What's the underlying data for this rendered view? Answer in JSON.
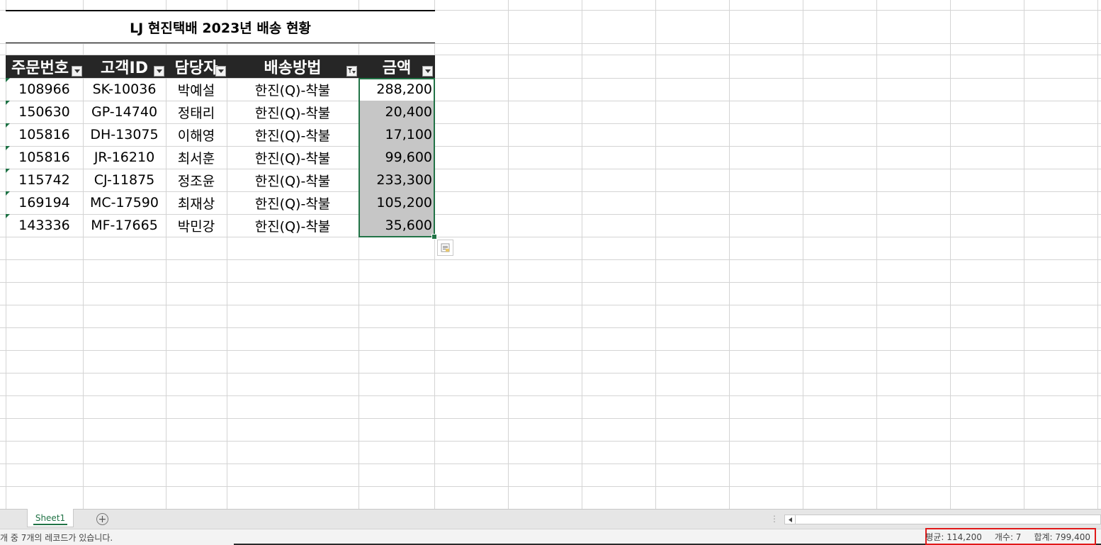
{
  "title": "LJ 현진택배 2023년 배송 현황",
  "table": {
    "headers": [
      "주문번호",
      "고객ID",
      "담당자",
      "배송방법",
      "금액"
    ],
    "rows": [
      [
        "108966",
        "SK-10036",
        "박예설",
        "한진(Q)-착불",
        "288,200"
      ],
      [
        "150630",
        "GP-14740",
        "정태리",
        "한진(Q)-착불",
        "20,400"
      ],
      [
        "105816",
        "DH-13075",
        "이해영",
        "한진(Q)-착불",
        "17,100"
      ],
      [
        "105816",
        "JR-16210",
        "최서훈",
        "한진(Q)-착불",
        "99,600"
      ],
      [
        "115742",
        "CJ-11875",
        "정조윤",
        "한진(Q)-착불",
        "233,300"
      ],
      [
        "169194",
        "MC-17590",
        "최재상",
        "한진(Q)-착불",
        "105,200"
      ],
      [
        "143336",
        "MF-17665",
        "박민강",
        "한진(Q)-착불",
        "35,600"
      ]
    ]
  },
  "sheet_tab": "Sheet1",
  "status": {
    "left_text": "개 중 7개의 레코드가 있습니다.",
    "average": "평균: 114,200",
    "count": "개수: 7",
    "sum": "합계: 799,400"
  },
  "colors": {
    "header_bg": "#262626",
    "selection_border": "#217346",
    "selected_fill": "#c6c6c6",
    "highlight_box": "#e01919"
  }
}
